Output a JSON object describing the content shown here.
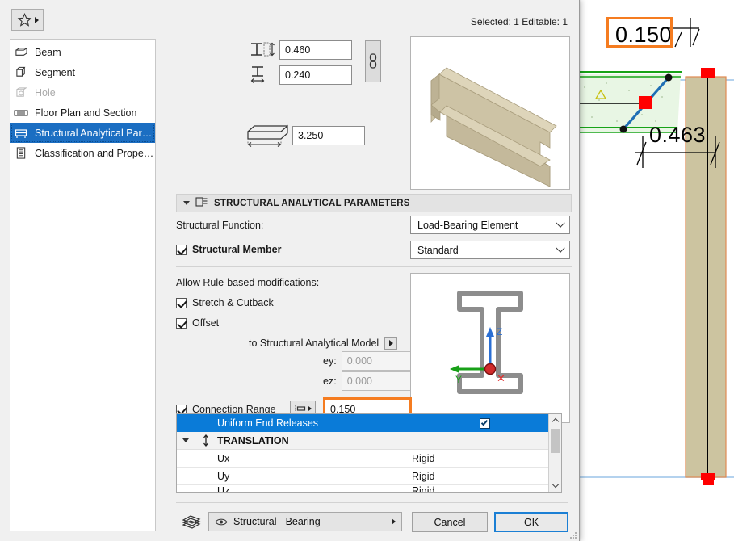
{
  "window": {
    "status_text": "Selected: 1 Editable: 1",
    "favorites_icon": "star-icon",
    "favorites_arrow": "triangle-right-icon"
  },
  "sidebar": {
    "items": [
      {
        "label": "Beam",
        "icon": "beam-icon",
        "state": "normal"
      },
      {
        "label": "Segment",
        "icon": "segment-cube-icon",
        "state": "normal"
      },
      {
        "label": "Hole",
        "icon": "hole-icon",
        "state": "disabled"
      },
      {
        "label": "Floor Plan and Section",
        "icon": "floor-plan-icon",
        "state": "normal"
      },
      {
        "label": "Structural Analytical Paramet...",
        "icon": "structural-analytical-icon",
        "state": "selected"
      },
      {
        "label": "Classification and Properties",
        "icon": "classification-icon",
        "state": "normal"
      }
    ]
  },
  "geometry": {
    "height_value": "0.460",
    "height_icon": "beam-height-icon",
    "width_value": "0.240",
    "width_icon": "beam-width-icon",
    "length_value": "3.250",
    "length_icon": "beam-length-icon",
    "link_icon": "chain-link-icon",
    "preview_icon": "beam-3d-preview"
  },
  "section": {
    "title": "STRUCTURAL ANALYTICAL PARAMETERS",
    "icon": "structural-analytical-icon",
    "collapse_icon": "caret-down-icon"
  },
  "parameters": {
    "structural_function_label": "Structural Function:",
    "structural_function_value": "Load-Bearing Element",
    "structural_member_label": "Structural Member",
    "structural_member_checked": true,
    "structural_member_value": "Standard",
    "allow_rules_label": "Allow Rule-based modifications:",
    "stretch_cutback_label": "Stretch & Cutback",
    "stretch_cutback_checked": true,
    "offset_label": "Offset",
    "offset_checked": true,
    "to_model_label": "to Structural Analytical Model",
    "to_model_arrow": "triangle-right-icon",
    "ey_label": "ey:",
    "ey_value": "0.000",
    "ez_label": "ez:",
    "ez_value": "0.000",
    "connection_range_label": "Connection Range",
    "connection_range_checked": true,
    "connection_range_icon": "connection-range-icon",
    "connection_range_value": "0.150",
    "cross_section_icon": "i-beam-axis-diagram",
    "axis_z_label": "Z",
    "axis_y_label": "Y",
    "axis_x_label": "X"
  },
  "releases": {
    "header_label": "Uniform End Releases",
    "header_checked": true,
    "group_label": "TRANSLATION",
    "group_icon": "translation-arrows-icon",
    "group_caret": "caret-down-icon",
    "rows": [
      {
        "name": "Ux",
        "value": "Rigid"
      },
      {
        "name": "Uy",
        "value": "Rigid"
      },
      {
        "name": "Uz",
        "value": "Rigid"
      }
    ],
    "scroll_up_icon": "chevron-up-icon",
    "scroll_down_icon": "chevron-down-icon"
  },
  "footer": {
    "layers_icon": "layers-stack-icon",
    "layer_eye_icon": "eye-icon",
    "layer_value": "Structural - Bearing",
    "layer_arrow": "triangle-right-icon",
    "cancel_label": "Cancel",
    "ok_label": "OK"
  },
  "cad": {
    "dimension_top": "0.150",
    "dimension_bottom": "0.463",
    "colors": {
      "highlight": "#f57c20",
      "slab_fill": "#e8f6e4",
      "slab_outline": "#17a317",
      "column_fill": "#ccc4a0",
      "column_outline": "#e08a52",
      "node_marker": "#ff0000",
      "beam_line": "#1f6fb5",
      "reference_line": "#9cc4e8"
    }
  },
  "theme": {
    "accent_blue": "#1b6ec2",
    "table_header_blue": "#0a7bd8",
    "dialog_bg": "#f0f0f0",
    "orange_highlight": "#f57c20"
  }
}
